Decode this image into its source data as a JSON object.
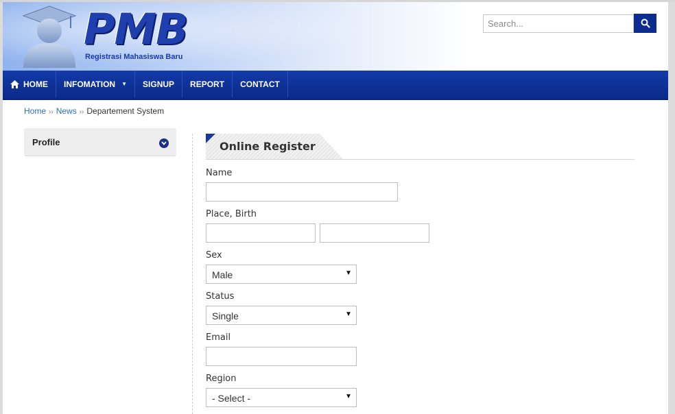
{
  "header": {
    "logo_text": "PMB",
    "logo_subtitle": "Registrasi Mahasiswa Baru",
    "search_placeholder": "Search..."
  },
  "nav": {
    "items": [
      {
        "label": "HOME",
        "icon": "home-icon"
      },
      {
        "label": "INFOMATION",
        "icon": "caret-down-icon"
      },
      {
        "label": "SIGNUP"
      },
      {
        "label": "REPORT"
      },
      {
        "label": "CONTACT"
      }
    ]
  },
  "breadcrumb": {
    "items": [
      "Home",
      "News",
      "Departement System"
    ],
    "separator": "››"
  },
  "sidebar": {
    "profile_title": "Profile"
  },
  "form": {
    "title": "Online Register",
    "name_label": "Name",
    "place_birth_label": "Place, Birth",
    "sex_label": "Sex",
    "sex_value": "Male",
    "status_label": "Status",
    "status_value": "Single",
    "email_label": "Email",
    "region_label": "Region",
    "region_value": "- Select -"
  },
  "colors": {
    "nav_bg": "#0b2a8a",
    "brand_blue": "#1f3fae",
    "link": "#2a6ebb"
  }
}
